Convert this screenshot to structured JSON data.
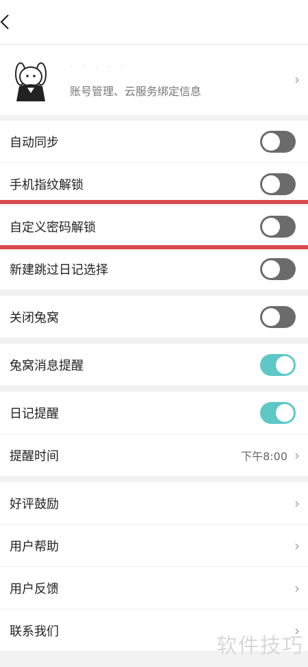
{
  "header": {
    "back_icon": "chevron-left-icon"
  },
  "account": {
    "name": "· · ·   · ·",
    "subtitle": "账号管理、云服务绑定信息",
    "chevron": "›"
  },
  "settings": {
    "auto_sync": {
      "label": "自动同步",
      "on": false
    },
    "fingerprint": {
      "label": "手机指纹解锁",
      "on": false
    },
    "custom_password": {
      "label": "自定义密码解锁",
      "on": false
    },
    "skip_diary_select": {
      "label": "新建跳过日记选择",
      "on": false
    },
    "close_rabbit_nest": {
      "label": "关闭兔窝",
      "on": false
    },
    "rabbit_msg_reminder": {
      "label": "兔窝消息提醒",
      "on": true
    },
    "diary_reminder": {
      "label": "日记提醒",
      "on": true
    },
    "reminder_time": {
      "label": "提醒时间",
      "value": "下午8:00"
    }
  },
  "links": {
    "rating": "好评鼓励",
    "help": "用户帮助",
    "feedback": "用户反馈",
    "contact": "联系我们"
  },
  "chevron": "›",
  "watermark": "软件技巧",
  "colors": {
    "toggle_on": "#5ec8c8",
    "toggle_off": "#6b6b6b",
    "highlight": "#d94a4f"
  }
}
